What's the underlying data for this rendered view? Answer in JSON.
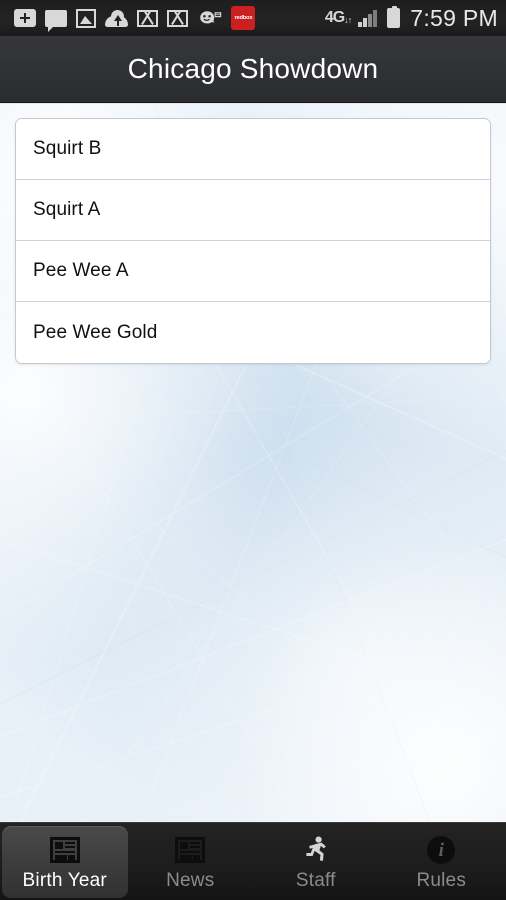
{
  "status_bar": {
    "clock": "7:59 PM",
    "network_type": "4G",
    "icons": [
      "tag-plus-icon",
      "message-bubble-icon",
      "photo-gallery-icon",
      "cloud-upload-icon",
      "gmail-icon",
      "gmail-icon",
      "waze-icon",
      "redbox-icon"
    ],
    "redbox_label": "redbox",
    "data_arrows": "↓↑",
    "signal_icon": "signal-bars-icon",
    "battery_icon": "battery-icon"
  },
  "header": {
    "title": "Chicago Showdown"
  },
  "main": {
    "list_items": [
      {
        "label": "Squirt B"
      },
      {
        "label": "Squirt A"
      },
      {
        "label": "Pee Wee A"
      },
      {
        "label": "Pee Wee Gold"
      }
    ]
  },
  "tab_bar": {
    "active_index": 0,
    "tabs": [
      {
        "label": "Birth Year",
        "icon": "list-layout-icon"
      },
      {
        "label": "News",
        "icon": "list-layout-icon"
      },
      {
        "label": "Staff",
        "icon": "running-person-icon"
      },
      {
        "label": "Rules",
        "icon": "info-circle-icon"
      }
    ]
  },
  "colors": {
    "title_bar": "#303235",
    "status_bar": "#232323",
    "tab_bar": "#1d1d1d",
    "tab_active": "#3d3d3d",
    "accent_red": "#cc1f1f",
    "ice_blue": "#cfe0ee",
    "card_white": "#ffffff"
  }
}
